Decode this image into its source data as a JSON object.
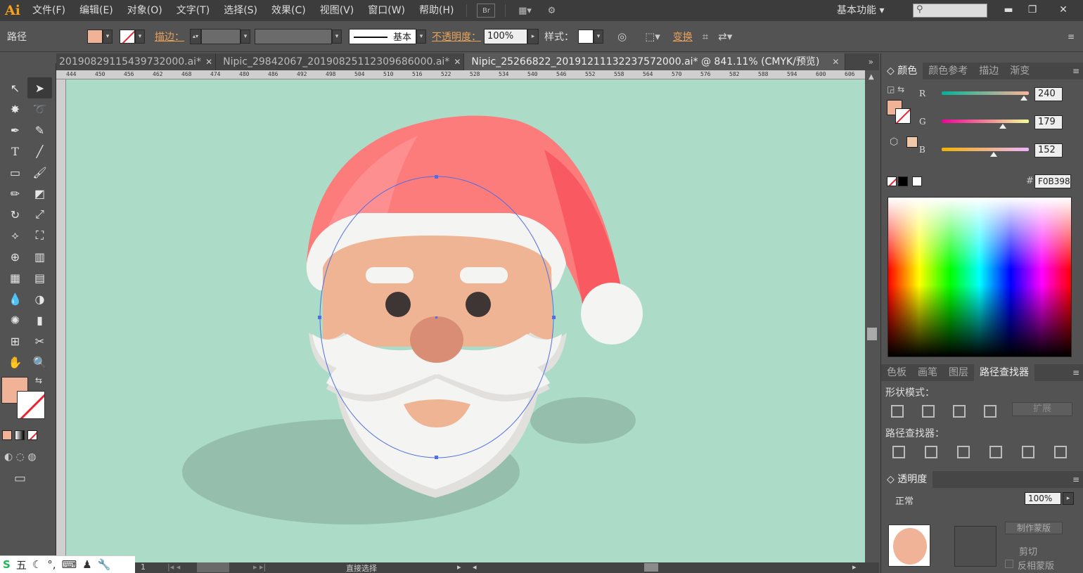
{
  "app": {
    "logo": "Ai"
  },
  "menu": [
    "文件(F)",
    "编辑(E)",
    "对象(O)",
    "文字(T)",
    "选择(S)",
    "效果(C)",
    "视图(V)",
    "窗口(W)",
    "帮助(H)"
  ],
  "menubar": {
    "br_label": "Br",
    "workspace": "基本功能"
  },
  "control": {
    "selection_type": "路径",
    "stroke_label": "描边：",
    "stroke_style": "基本",
    "opacity_label": "不透明度：",
    "opacity_value": "100%",
    "style_label": "样式：",
    "transform_label": "变换"
  },
  "tabs": [
    {
      "title": "20190829115439732000.ai*",
      "active": false
    },
    {
      "title": "Nipic_29842067_20190825112309686000.ai*",
      "active": false
    },
    {
      "title": "Nipic_25266822_20191211132237572000.ai* @ 841.11% (CMYK/预览)",
      "active": true
    }
  ],
  "ruler_ticks": [
    "444",
    "450",
    "456",
    "462",
    "468",
    "474",
    "480",
    "486",
    "492",
    "498",
    "504",
    "510",
    "516",
    "522",
    "528",
    "534",
    "540",
    "546",
    "552",
    "558",
    "564",
    "570",
    "576",
    "582",
    "588",
    "594",
    "600",
    "606"
  ],
  "color_panel": {
    "tabs": [
      "颜色",
      "颜色参考",
      "描边",
      "渐变"
    ],
    "r": "240",
    "g": "179",
    "b": "152",
    "r_fraction": 0.94,
    "g_fraction": 0.7,
    "b_fraction": 0.6,
    "hex": "F0B398",
    "fill_color": "#f0b398"
  },
  "pathfinder_panel": {
    "tabs": [
      "色板",
      "画笔",
      "图层",
      "路径查找器"
    ],
    "shape_modes_label": "形状模式：",
    "pathfinders_label": "路径查找器：",
    "expand_label": "扩展"
  },
  "transparency_panel": {
    "title": "透明度",
    "blend_mode": "正常",
    "opacity_value": "100%",
    "make_mask_label": "制作蒙版",
    "clip_label": "剪切",
    "invert_mask_label": "反相蒙版"
  },
  "status": {
    "zoom_page": "1",
    "tool_name": "直接选择"
  },
  "ime": {
    "logo": "S",
    "mode": "五"
  },
  "colors": {
    "background": "#acdcc8",
    "hat": "#fc7b7b",
    "hat_shade": "#f95a61",
    "face": "#eeb494",
    "nose": "#d98d74",
    "beard": "#f4f4f3",
    "shadow": "#95bead",
    "selection": "#4f6fe6"
  }
}
